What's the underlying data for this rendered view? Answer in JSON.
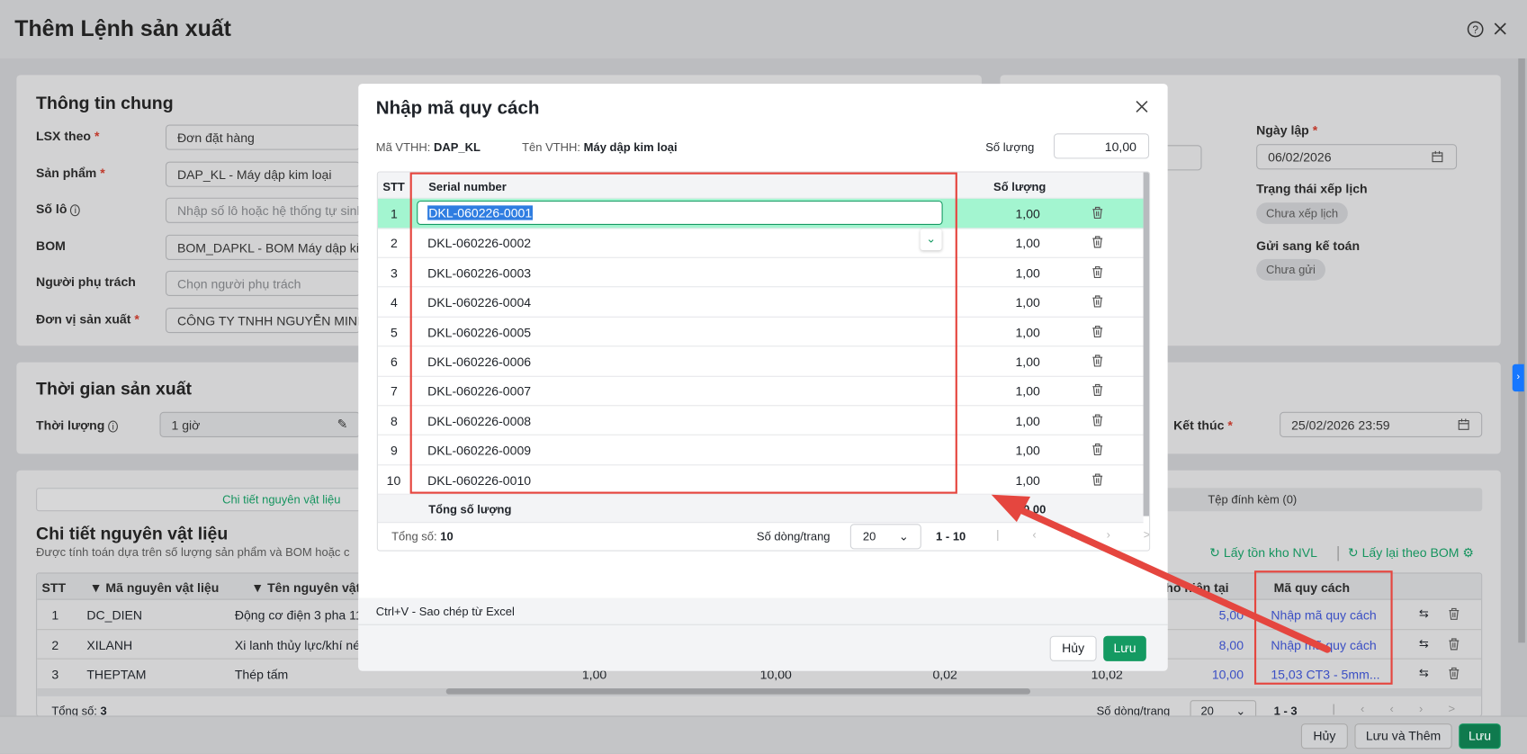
{
  "page": {
    "title": "Thêm Lệnh sản xuất",
    "help_icon": "question-circle-icon",
    "close_icon": "close-icon"
  },
  "general": {
    "title": "Thông tin chung",
    "fields": [
      {
        "label": "LSX theo",
        "required": true,
        "value": "Đơn đặt hàng"
      },
      {
        "label": "Sản phẩm",
        "required": true,
        "value": "DAP_KL - Máy dập kim loại"
      },
      {
        "label": "Số lô",
        "info": true,
        "placeholder": "Nhập số lô hoặc hệ thống tự sinh"
      },
      {
        "label": "BOM",
        "value": "BOM_DAPKL - BOM Máy dập kim"
      },
      {
        "label": "Người phụ trách",
        "placeholder": "Chọn người phụ trách"
      },
      {
        "label": "Đơn vị sản xuất",
        "required": true,
        "value": "CÔNG TY TNHH NGUYỄN MINH"
      }
    ]
  },
  "side": {
    "date_label": "Ngày lập",
    "date_value": "06/02/2026",
    "schedule_label": "Trạng thái xếp lịch",
    "schedule_value": "Chưa xếp lịch",
    "accounting_label": "Gửi sang kế toán",
    "accounting_value": "Chưa gửi"
  },
  "time": {
    "title": "Thời gian sản xuất",
    "duration_label": "Thời lượng",
    "duration_value": "1 giờ",
    "end_label": "Kết thúc",
    "end_value": "25/02/2026 23:59"
  },
  "materials": {
    "tab_active": "Chi tiết nguyên vật liệu",
    "tab_attachments": "Tệp đính kèm (0)",
    "title": "Chi tiết nguyên vật liệu",
    "subtitle": "Được tính toán dựa trên số lượng sản phẩm và BOM hoặc c",
    "action_stock": "Lấy tồn kho NVL",
    "action_bom": "Lấy lại theo BOM",
    "columns": [
      "STT",
      "Mã nguyên vật liệu",
      "Tên nguyên vật li",
      "n kho hiện tại",
      "Mã quy cách"
    ],
    "rows": [
      {
        "stt": "1",
        "code": "DC_DIEN",
        "name": "Động cơ điện 3 pha 11-",
        "c1": "",
        "c2": "",
        "c3": "",
        "c4": "",
        "stock": "5,00",
        "spec": "Nhập mã quy cách"
      },
      {
        "stt": "2",
        "code": "XILANH",
        "name": "Xi lanh thủy lực/khí nén",
        "c1": "",
        "c2": "",
        "c3": "",
        "c4": "",
        "stock": "8,00",
        "spec": "Nhập mã quy cách"
      },
      {
        "stt": "3",
        "code": "THEPTAM",
        "name": "Thép tấm",
        "c1": "1,00",
        "c2": "10,00",
        "c3": "0,02",
        "c4": "10,02",
        "stock": "10,00",
        "spec": "15,03 CT3 - 5mm..."
      }
    ],
    "total_label": "Tổng số:",
    "total": "3",
    "page_size_label": "Số dòng/trang",
    "page_size": "20",
    "range": "1 - 3"
  },
  "footer": {
    "cancel": "Hủy",
    "save_add": "Lưu và Thêm",
    "save": "Lưu"
  },
  "modal": {
    "title": "Nhập mã quy cách",
    "code_label": "Mã VTHH:",
    "code": "DAP_KL",
    "name_label": "Tên VTHH:",
    "name": "Máy dập kim loại",
    "qty_label": "Số lượng",
    "qty": "10,00",
    "columns": {
      "stt": "STT",
      "serial": "Serial number",
      "qty": "Số lượng"
    },
    "rows": [
      {
        "stt": "1",
        "serial": "DKL-060226-0001",
        "qty": "1,00"
      },
      {
        "stt": "2",
        "serial": "DKL-060226-0002",
        "qty": "1,00"
      },
      {
        "stt": "3",
        "serial": "DKL-060226-0003",
        "qty": "1,00"
      },
      {
        "stt": "4",
        "serial": "DKL-060226-0004",
        "qty": "1,00"
      },
      {
        "stt": "5",
        "serial": "DKL-060226-0005",
        "qty": "1,00"
      },
      {
        "stt": "6",
        "serial": "DKL-060226-0006",
        "qty": "1,00"
      },
      {
        "stt": "7",
        "serial": "DKL-060226-0007",
        "qty": "1,00"
      },
      {
        "stt": "8",
        "serial": "DKL-060226-0008",
        "qty": "1,00"
      },
      {
        "stt": "9",
        "serial": "DKL-060226-0009",
        "qty": "1,00"
      },
      {
        "stt": "10",
        "serial": "DKL-060226-0010",
        "qty": "1,00"
      }
    ],
    "sum_label": "Tổng số lượng",
    "sum_value": "10,00",
    "total_label": "Tổng số:",
    "total": "10",
    "page_size_label": "Số dòng/trang",
    "page_size": "20",
    "range": "1 - 10",
    "hint": "Ctrl+V - Sao chép từ Excel",
    "cancel": "Hủy",
    "save": "Lưu"
  },
  "colors": {
    "primary": "#149a62",
    "selected_row": "#a3f5d0",
    "link": "#3b4fc4",
    "annotation": "#e5463f"
  }
}
